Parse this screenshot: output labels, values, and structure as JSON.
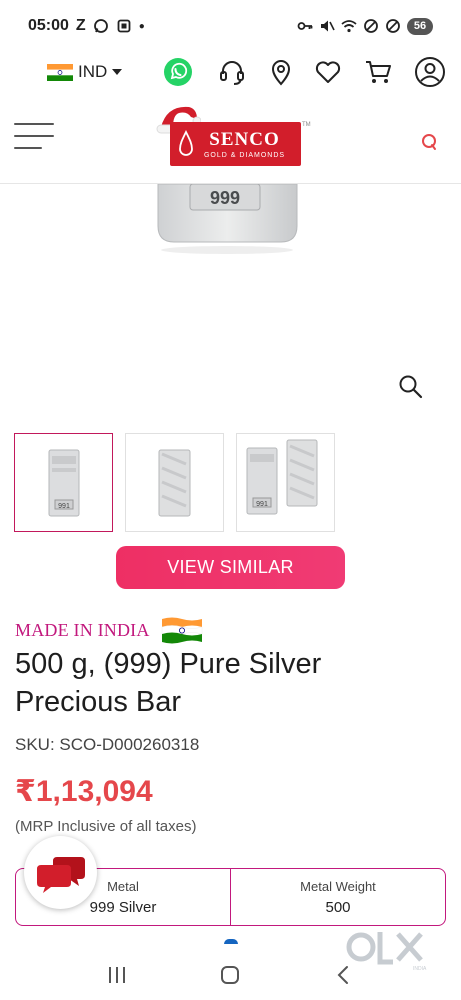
{
  "status_bar": {
    "time": "05:00",
    "left_letter": "Z",
    "battery": "56"
  },
  "top_bar": {
    "country": "IND",
    "icons": [
      "whatsapp-icon",
      "headset-icon",
      "location-pin-icon",
      "heart-icon",
      "cart-icon",
      "user-icon"
    ]
  },
  "header": {
    "logo_main": "SENCO",
    "logo_sub": "GOLD & DIAMONDS",
    "trademark": "TM"
  },
  "product_image": {
    "stamp": "999"
  },
  "thumbnails": {
    "items": [
      {
        "stamp": "991",
        "active": true
      },
      {
        "stamp": "",
        "active": false
      },
      {
        "stamp": "991",
        "active": false
      }
    ]
  },
  "view_similar_label": "VIEW SIMILAR",
  "made_in_india": "MADE IN INDIA",
  "product": {
    "title": "500 g, (999) Pure Silver Precious Bar",
    "sku": "SKU: SCO-D000260318",
    "price": "₹1,13,094",
    "mrp_note": "(MRP Inclusive of all taxes)"
  },
  "specs": [
    {
      "label": "Metal",
      "value": "999 Silver"
    },
    {
      "label": "Metal Weight",
      "value": "500"
    }
  ],
  "watermark": {
    "text": "OLX",
    "sub": "INDIA"
  },
  "colors": {
    "brand_red": "#d21e2b",
    "accent_pink": "#ee2f64",
    "made_in_india": "#c2187d",
    "price": "#e5474b",
    "whatsapp": "#25d366"
  }
}
